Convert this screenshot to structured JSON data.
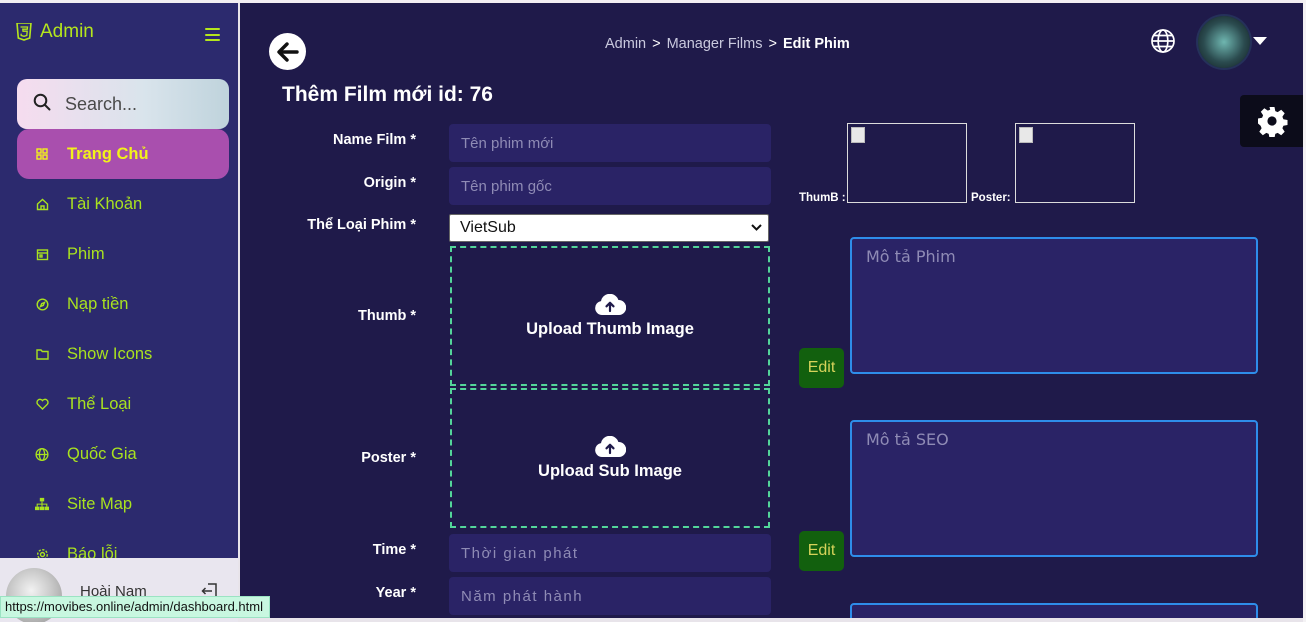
{
  "sidebar": {
    "brand": "Admin",
    "search": {
      "placeholder": "Search..."
    },
    "items": [
      {
        "label": "Trang Chủ",
        "icon": "grid-icon",
        "active": true
      },
      {
        "label": "Tài Khoản",
        "icon": "home-icon"
      },
      {
        "label": "Phim",
        "icon": "calendar-icon"
      },
      {
        "label": "Nạp tiền",
        "icon": "compass-icon"
      },
      {
        "label": "Show Icons",
        "icon": "folder-icon"
      },
      {
        "label": "Thể Loại",
        "icon": "heart-icon"
      },
      {
        "label": "Quốc Gia",
        "icon": "globe-icon"
      },
      {
        "label": "Site Map",
        "icon": "sitemap-icon"
      },
      {
        "label": "Báo lỗi",
        "icon": "gear-icon"
      }
    ],
    "user": {
      "name": "Hoài Nam"
    }
  },
  "status_url": "https://movibes.online/admin/dashboard.html",
  "header": {
    "breadcrumb": [
      "Admin",
      "Manager Films",
      "Edit Phim"
    ],
    "separator": ">"
  },
  "page_title": "Thêm Film mới id: 76",
  "form": {
    "name_label": "Name Film *",
    "name_placeholder": "Tên phim mới",
    "origin_label": "Origin *",
    "origin_placeholder": "Tên phim gốc",
    "genre_label": "Thể Loại Phim *",
    "genre_value": "VietSub",
    "thumb_label": "Thumb *",
    "thumb_upload": "Upload Thumb Image",
    "poster_label": "Poster *",
    "poster_upload": "Upload Sub Image",
    "time_label": "Time *",
    "time_placeholder": "Thời gian phát",
    "year_label": "Year *",
    "year_placeholder": "Năm phát hành"
  },
  "preview": {
    "thumb_label": "ThumB :",
    "poster_label": "Poster:"
  },
  "descriptions": {
    "film_placeholder": "Mô tả Phim",
    "seo_placeholder": "Mô tả SEO",
    "edit_label": "Edit"
  },
  "colors": {
    "sidebar_bg": "#2c2a6e",
    "main_bg": "#1f1a4a",
    "accent": "#a9e21f",
    "active_bg": "#a94fae"
  }
}
